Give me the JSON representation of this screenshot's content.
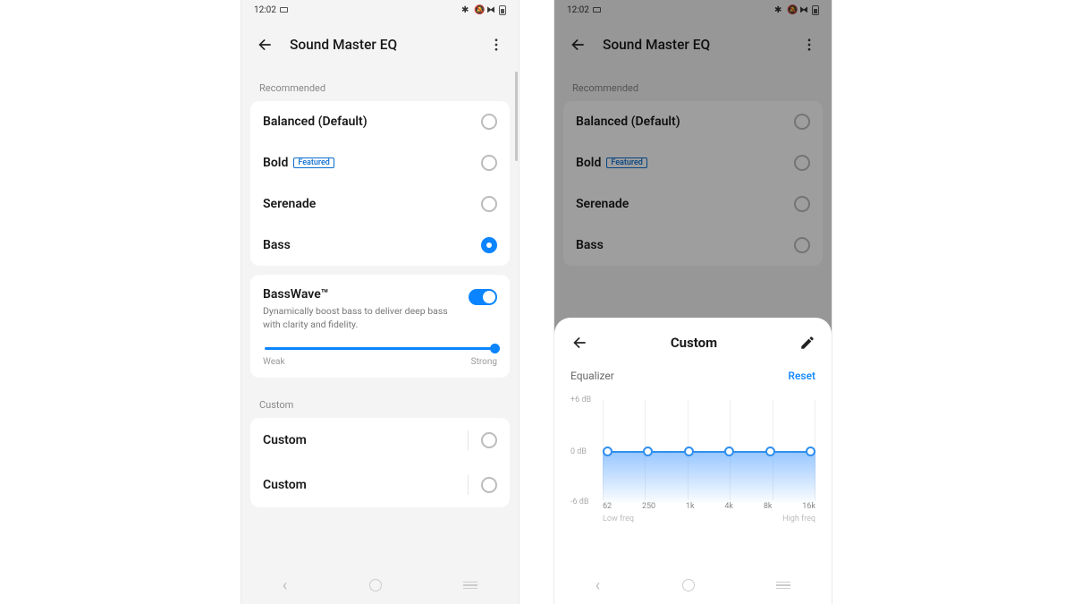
{
  "status": {
    "time": "12:02"
  },
  "header": {
    "title": "Sound Master EQ"
  },
  "sections": {
    "recommended_label": "Recommended",
    "custom_label": "Custom"
  },
  "presets": {
    "balanced": {
      "label": "Balanced (Default)",
      "selected": false
    },
    "bold": {
      "label": "Bold",
      "badge": "Featured",
      "selected": false
    },
    "serenade": {
      "label": "Serenade",
      "selected": false
    },
    "bass": {
      "label": "Bass",
      "selected": true
    }
  },
  "basswave": {
    "title": "BassWave™",
    "description": "Dynamically boost bass to deliver deep bass with clarity and fidelity.",
    "enabled": true,
    "slider": {
      "value": 100,
      "min_label": "Weak",
      "max_label": "Strong"
    }
  },
  "custom_presets": [
    {
      "label": "Custom",
      "selected": false
    },
    {
      "label": "Custom",
      "selected": false
    }
  ],
  "sheet": {
    "title": "Custom",
    "equalizer_label": "Equalizer",
    "reset_label": "Reset",
    "low_freq_label": "Low freq",
    "high_freq_label": "High freq",
    "chart_data": {
      "type": "line",
      "y_ticks": [
        "+6 dB",
        "0 dB",
        "-6 dB"
      ],
      "x_ticks": [
        "62",
        "250",
        "1k",
        "4k",
        "8k",
        "16k"
      ],
      "bands": [
        {
          "freq": "62",
          "gain_db": 0
        },
        {
          "freq": "250",
          "gain_db": 0
        },
        {
          "freq": "1k",
          "gain_db": 0
        },
        {
          "freq": "4k",
          "gain_db": 0
        },
        {
          "freq": "8k",
          "gain_db": 0
        },
        {
          "freq": "16k",
          "gain_db": 0
        }
      ],
      "ylim_db": [
        -6,
        6
      ]
    }
  }
}
